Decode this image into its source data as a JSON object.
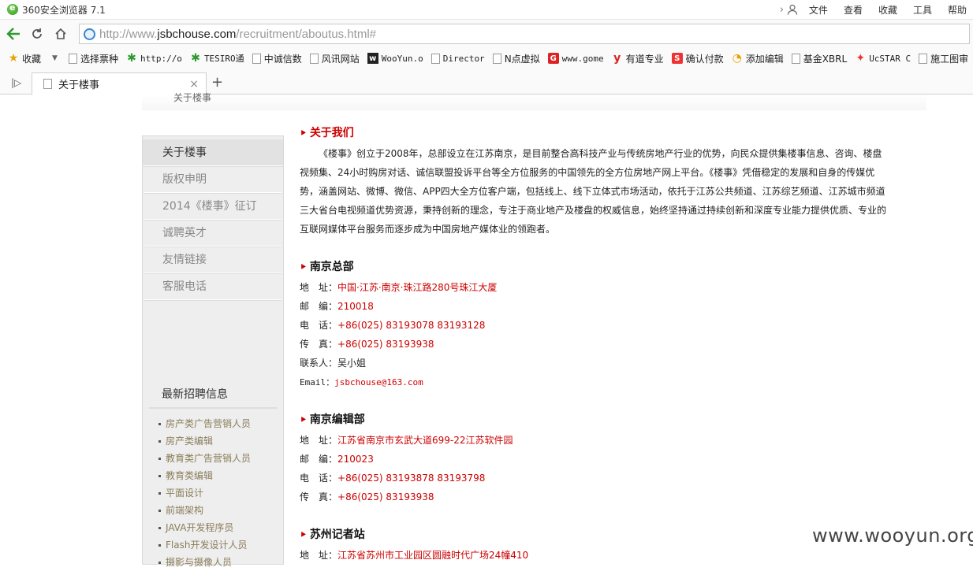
{
  "browser": {
    "title": "360安全浏览器 7.1",
    "menu": [
      "文件",
      "查看",
      "收藏",
      "工具",
      "帮助"
    ],
    "url_prefix": "http://www.",
    "url_domain": "jsbchouse.com",
    "url_path": "/recruitment/aboutus.html#",
    "favorites": [
      {
        "label": "收藏",
        "icon": "star-icon"
      },
      {
        "label": "选择票种",
        "icon": "page-icon"
      },
      {
        "label": "http://o",
        "icon": "gear-icon"
      },
      {
        "label": "TESIRO通",
        "icon": "gear-icon"
      },
      {
        "label": "中诚信数",
        "icon": "page-icon"
      },
      {
        "label": "风讯网站",
        "icon": "page-icon"
      },
      {
        "label": "WooYun.o",
        "icon": "wooyun-icon"
      },
      {
        "label": "Director",
        "icon": "page-icon"
      },
      {
        "label": "N点虚拟",
        "icon": "page-icon"
      },
      {
        "label": "www.gome",
        "icon": "gome-icon"
      },
      {
        "label": "有道专业",
        "icon": "youdao-icon"
      },
      {
        "label": "确认付款",
        "icon": "s-icon"
      },
      {
        "label": "添加编辑",
        "icon": "swirl-icon"
      },
      {
        "label": "基金XBRL",
        "icon": "page-icon"
      },
      {
        "label": "UcSTAR C",
        "icon": "ucstar-icon"
      },
      {
        "label": "施工图审",
        "icon": "page-icon"
      }
    ],
    "tab_label": "关于楼事"
  },
  "page": {
    "breadcrumb": "关于楼事",
    "sidebar": {
      "items": [
        "关于楼事",
        "版权申明",
        "2014《楼事》征订",
        "诚聘英才",
        "友情链接",
        "客服电话"
      ],
      "jobs_title": "最新招聘信息",
      "jobs": [
        "房产类广告营销人员",
        "房产类编辑",
        "教育类广告营销人员",
        "教育类编辑",
        "平面设计",
        "前端架构",
        "JAVA开发程序员",
        "Flash开发设计人员",
        "摄影与摄像人员"
      ]
    },
    "about": {
      "title": "关于我们",
      "text": "《楼事》创立于2008年，总部设立在江苏南京，是目前整合高科技产业与传统房地产行业的优势，向民众提供集楼事信息、咨询、楼盘视频集、24小时购房对话、诚信联盟投诉平台等全方位服务的中国领先的全方位房地产网上平台。《楼事》凭借稳定的发展和自身的传媒优势，涵盖网站、微博、微信、APP四大全方位客户端，包括线上、线下立体式市场活动，依托于江苏公共频道、江苏综艺频道、江苏城市频道三大省台电视频道优势资源，秉持创新的理念，专注于商业地产及楼盘的权威信息，始终坚持通过持续创新和深度专业能力提供优质、专业的互联网媒体平台服务而逐步成为中国房地产媒体业的领跑者。"
    },
    "hq": {
      "title": "南京总部",
      "address_label": "地　址：",
      "address": "中国·江苏·南京·珠江路280号珠江大厦",
      "zip_label": "邮　编：",
      "zip": "210018",
      "phone_label": "电　话：",
      "phone": "+86(025) 83193078 83193128",
      "fax_label": "传　真：",
      "fax": "+86(025) 83193938",
      "contact_label": "联系人：",
      "contact": "吴小姐",
      "email_label": "Email：",
      "email": "jsbchouse@163.com"
    },
    "editorial": {
      "title": "南京编辑部",
      "address_label": "地　址：",
      "address": "江苏省南京市玄武大道699-22江苏软件园",
      "zip_label": "邮　编：",
      "zip": "210023",
      "phone_label": "电　话：",
      "phone": "+86(025) 83193878 83193798",
      "fax_label": "传　真：",
      "fax": "+86(025) 83193938"
    },
    "suzhou": {
      "title": "苏州记者站",
      "address_label": "地　址：",
      "address": "江苏省苏州市工业园区圆融时代广场24幢410"
    }
  },
  "watermark": "www.wooyun.org"
}
